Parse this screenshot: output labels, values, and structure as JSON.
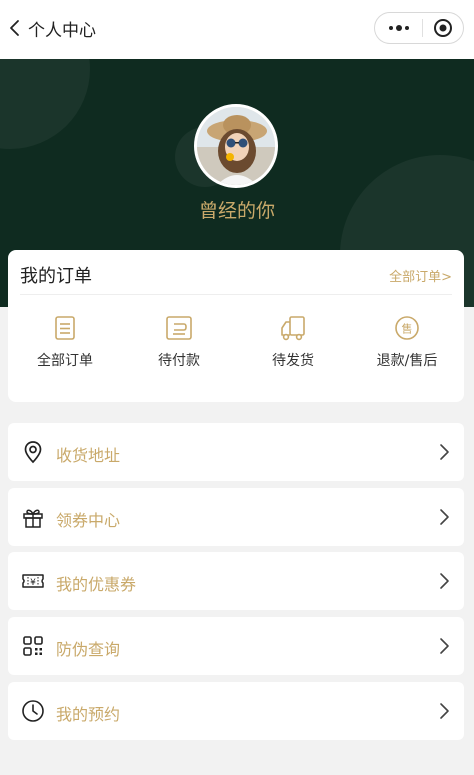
{
  "nav": {
    "title": "个人中心",
    "back_icon": "chevron-left-icon",
    "more_icon": "more-dots-icon",
    "close_icon": "target-close-icon"
  },
  "profile": {
    "username": "曾经的你",
    "avatar_icon": "avatar-photo"
  },
  "orders": {
    "title": "我的订单",
    "view_all": "全部订单>",
    "items": [
      {
        "label": "全部订单",
        "icon": "document-list-icon"
      },
      {
        "label": "待付款",
        "icon": "wallet-icon"
      },
      {
        "label": "待发货",
        "icon": "truck-icon"
      },
      {
        "label": "退款/售后",
        "icon": "after-sales-icon"
      }
    ]
  },
  "menu": [
    {
      "label": "收货地址",
      "icon": "location-pin-icon"
    },
    {
      "label": "领券中心",
      "icon": "gift-icon"
    },
    {
      "label": "我的优惠券",
      "icon": "coupon-yen-icon"
    },
    {
      "label": "防伪查询",
      "icon": "qr-code-icon"
    },
    {
      "label": "我的预约",
      "icon": "clock-icon"
    }
  ],
  "colors": {
    "header_bg": "#0f2b20",
    "accent_gold": "#c9a96a",
    "page_bg": "#f2f2f2"
  }
}
